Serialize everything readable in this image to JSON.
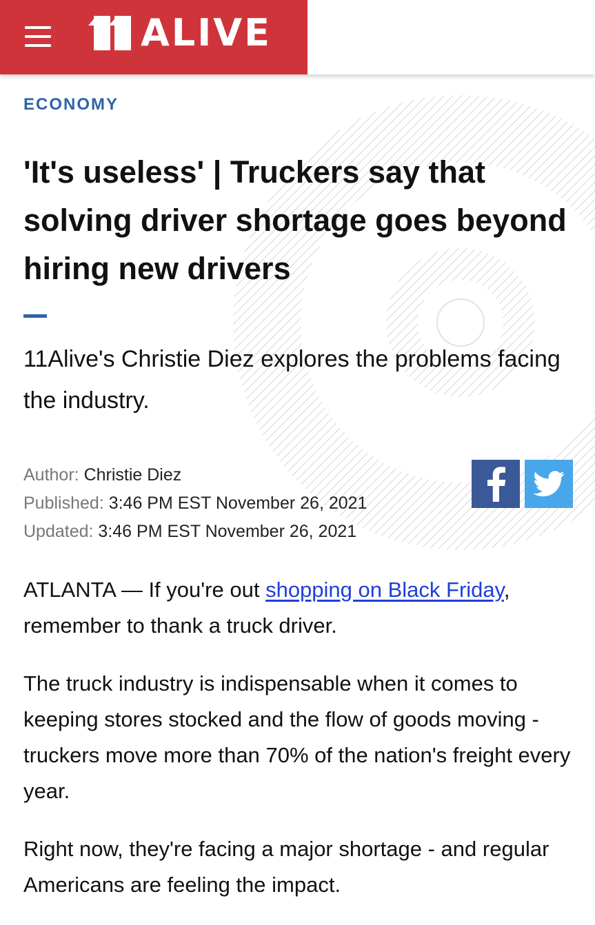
{
  "header": {
    "logo_text": "ALIVE",
    "logo_number": "11",
    "brand_color": "#cf343b"
  },
  "article": {
    "category": "ECONOMY",
    "headline": "'It's useless' | Truckers say that solving driver shortage goes beyond hiring new drivers",
    "subhead": "11Alive's Christie Diez explores the problems facing the industry.",
    "meta": {
      "author_label": "Author:",
      "author": "Christie Diez",
      "published_label": "Published:",
      "published": "3:46 PM EST November 26, 2021",
      "updated_label": "Updated:",
      "updated": "3:46 PM EST November 26, 2021"
    },
    "share": {
      "facebook_icon": "facebook-icon",
      "twitter_icon": "twitter-icon",
      "facebook_color": "#3b5998",
      "twitter_color": "#48a6ea"
    },
    "body": {
      "p1_prefix": "ATLANTA — If you're out ",
      "p1_link": "shopping on Black Friday",
      "p1_suffix": ", remember to thank a truck driver.",
      "p2": "The truck industry is indispensable when it comes to keeping stores stocked and the flow of goods moving - truckers move more than 70% of the nation's freight every year.",
      "p3": "Right now, they're facing a major shortage - and regular Americans are feeling the impact."
    },
    "accent_color": "#2f63a8",
    "link_color": "#1f3fd8"
  }
}
